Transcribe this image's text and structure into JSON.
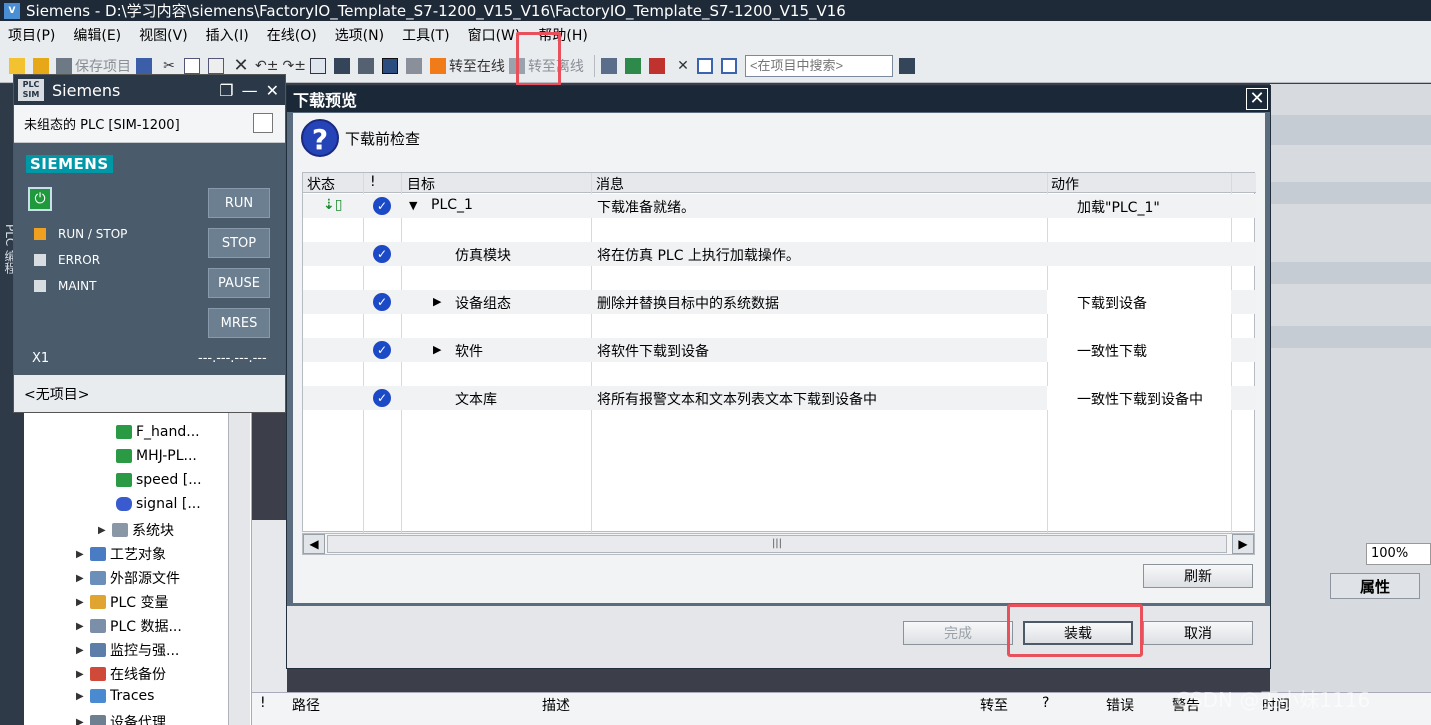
{
  "title_bar": {
    "text": "Siemens  -  D:\\学习内容\\siemens\\FactoryIO_Template_S7-1200_V15_V16\\FactoryIO_Template_S7-1200_V15_V16"
  },
  "menu": [
    "项目(P)",
    "编辑(E)",
    "视图(V)",
    "插入(I)",
    "在线(O)",
    "选项(N)",
    "工具(T)",
    "窗口(W)",
    "帮助(H)"
  ],
  "toolbar": {
    "save_label": "保存项目",
    "go_online_label": "转至在线",
    "go_offline_label": "转至离线",
    "search_placeholder": "<在项目中搜索>"
  },
  "plcsim": {
    "title": "Siemens",
    "logo": "PLC SIM",
    "subtitle": "未组态的 PLC [SIM-1200]",
    "brand": "SIEMENS",
    "leds": [
      "RUN / STOP",
      "ERROR",
      "MAINT"
    ],
    "buttons": [
      "RUN",
      "STOP",
      "PAUSE",
      "MRES"
    ],
    "x1_label": "X1",
    "x1_value": "---.---.---.---",
    "footer": "<无项目>"
  },
  "side_label": "PLC 编程",
  "tree": [
    {
      "label": "F_hand...",
      "indent": 3,
      "icon": "fb-icon"
    },
    {
      "label": "MHJ-PL...",
      "indent": 3,
      "icon": "fb-icon"
    },
    {
      "label": "speed [...",
      "indent": 3,
      "icon": "fb-icon"
    },
    {
      "label": "signal [...",
      "indent": 3,
      "icon": "db-icon"
    },
    {
      "label": "系统块",
      "indent": 2,
      "icon": "system-block-icon"
    },
    {
      "label": "工艺对象",
      "indent": 1,
      "icon": "technology-icon"
    },
    {
      "label": "外部源文件",
      "indent": 1,
      "icon": "external-source-icon"
    },
    {
      "label": "PLC 变量",
      "indent": 1,
      "icon": "tag-icon"
    },
    {
      "label": "PLC 数据...",
      "indent": 1,
      "icon": "datatype-icon"
    },
    {
      "label": "监控与强...",
      "indent": 1,
      "icon": "watch-icon"
    },
    {
      "label": "在线备份",
      "indent": 1,
      "icon": "backup-icon"
    },
    {
      "label": "Traces",
      "indent": 1,
      "icon": "trace-icon"
    },
    {
      "label": "设备代理...",
      "indent": 1,
      "icon": "proxy-icon"
    }
  ],
  "background": {
    "zoom": "100%",
    "properties_tab": "属性",
    "bottom_headers": [
      "!",
      "路径",
      "描述",
      "转至",
      "?",
      "错误",
      "警告",
      "时间"
    ],
    "watermark": "CSDN @王小妹1116"
  },
  "dialog": {
    "title": "下载预览",
    "header": "下载前检查",
    "columns": [
      "状态",
      "!",
      "目标",
      "消息",
      "动作"
    ],
    "rows": [
      {
        "target": "PLC_1",
        "message": "下载准备就绪。",
        "action": "加载\"PLC_1\"",
        "has_status": true,
        "expand": "down",
        "indent": 0
      },
      {
        "target": "仿真模块",
        "message": "将在仿真 PLC 上执行加载操作。",
        "action": "",
        "has_status": false,
        "expand": "",
        "indent": 1
      },
      {
        "target": "设备组态",
        "message": "删除并替换目标中的系统数据",
        "action": "下载到设备",
        "has_status": false,
        "expand": "right",
        "indent": 1
      },
      {
        "target": "软件",
        "message": "将软件下载到设备",
        "action": "一致性下载",
        "has_status": false,
        "expand": "right",
        "indent": 1
      },
      {
        "target": "文本库",
        "message": "将所有报警文本和文本列表文本下载到设备中",
        "action": "一致性下载到设备中",
        "has_status": false,
        "expand": "",
        "indent": 1
      }
    ],
    "refresh_label": "刷新",
    "finish_label": "完成",
    "load_label": "装载",
    "cancel_label": "取消"
  }
}
